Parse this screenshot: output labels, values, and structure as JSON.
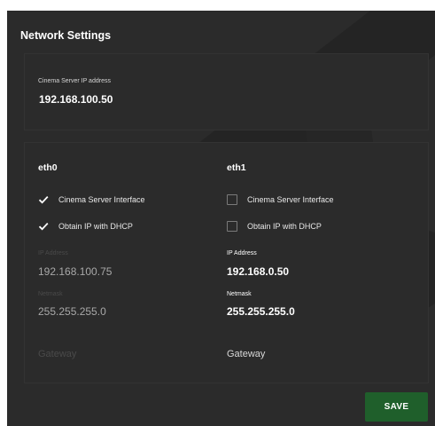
{
  "panel": {
    "title": "Network Settings"
  },
  "server": {
    "ip_label": "Cinema Server IP address",
    "ip_value": "192.168.100.50"
  },
  "eth0": {
    "title": "eth0",
    "cinema_server_interface": {
      "label": "Cinema Server Interface",
      "checked": true
    },
    "obtain_dhcp": {
      "label": "Obtain IP with DHCP",
      "checked": true
    },
    "ip_label": "IP Address",
    "ip_value": "192.168.100.75",
    "netmask_label": "Netmask",
    "netmask_value": "255.255.255.0",
    "gateway_placeholder": "Gateway"
  },
  "eth1": {
    "title": "eth1",
    "cinema_server_interface": {
      "label": "Cinema Server Interface",
      "checked": false
    },
    "obtain_dhcp": {
      "label": "Obtain IP with DHCP",
      "checked": false
    },
    "ip_label": "IP Address",
    "ip_value": "192.168.0.50",
    "netmask_label": "Netmask",
    "netmask_value": "255.255.255.0",
    "gateway_placeholder": "Gateway"
  },
  "actions": {
    "save_label": "SAVE"
  },
  "colors": {
    "panel_bg": "#2b2b2b",
    "save_button": "#1f5f2b",
    "text": "#ffffff"
  },
  "icons": {
    "checkbox_checked": "check-icon",
    "watermark": "watermark-logo"
  }
}
